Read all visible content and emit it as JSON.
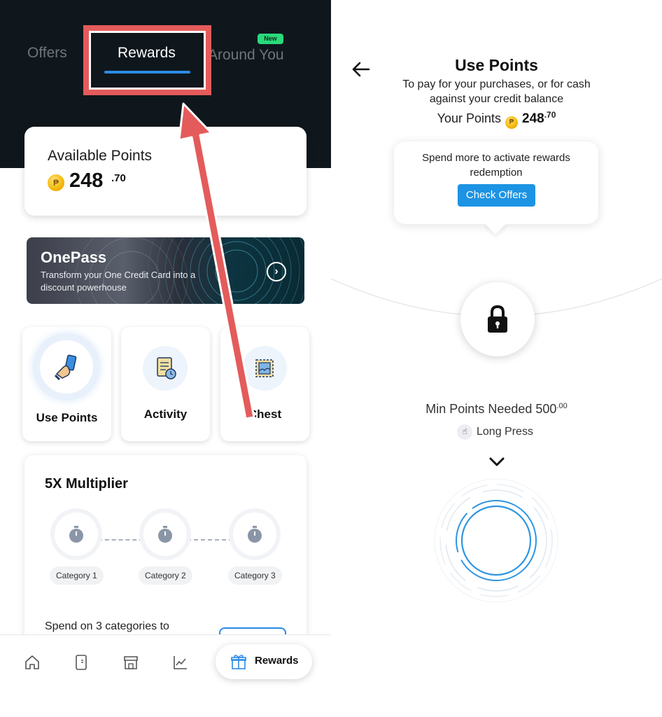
{
  "left": {
    "tabs": {
      "offers": "Offers",
      "rewards": "Rewards",
      "around_you": "Around You",
      "new_badge": "New"
    },
    "available_points": {
      "label": "Available Points",
      "coin_symbol": "₱",
      "value": "248",
      "decimal": ".70"
    },
    "onepass": {
      "title": "OnePass",
      "subtitle": "Transform your One Credit Card into a discount powerhouse",
      "arrow": "›"
    },
    "tiles": [
      {
        "label": "Use Points",
        "icon": "hand-card-icon"
      },
      {
        "label": "Activity",
        "icon": "receipt-clock-icon"
      },
      {
        "label": "Chest",
        "icon": "stamp-icon"
      }
    ],
    "multiplier": {
      "title": "5X Multiplier",
      "categories": [
        "Category 1",
        "Category 2",
        "Category 3"
      ],
      "description": "Spend on 3 categories to"
    },
    "bottom_nav": {
      "items": [
        "home-icon",
        "card-icon",
        "store-icon",
        "chart-icon"
      ],
      "active_label": "Rewards",
      "active_icon": "gift-icon"
    }
  },
  "right": {
    "title": "Use Points",
    "subtitle": "To pay for your purchases, or for cash against your credit balance",
    "your_points_label": "Your Points",
    "your_points_value": "248",
    "your_points_decimal": ".70",
    "tooltip": {
      "text": "Spend more to activate rewards redemption",
      "cta": "Check Offers"
    },
    "min_points_label": "Min Points Needed 500",
    "min_points_decimal": ".00",
    "long_press_label": "Long Press"
  },
  "colors": {
    "accent": "#2b8be6",
    "highlight": "#e45b5b",
    "header_bg": "#0f171d",
    "cta": "#1d93e3",
    "coin": "#f2b705"
  }
}
